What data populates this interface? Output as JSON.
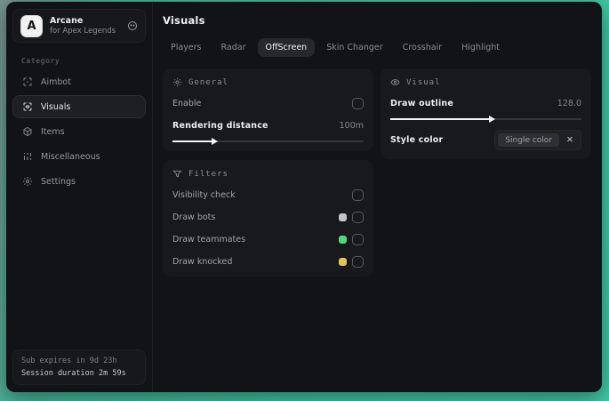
{
  "app": {
    "title": "Arcane",
    "subtitle": "for Apex Legends",
    "logo_letter": "A"
  },
  "sidebar": {
    "category_label": "Category",
    "items": [
      {
        "label": "Aimbot"
      },
      {
        "label": "Visuals"
      },
      {
        "label": "Items"
      },
      {
        "label": "Miscellaneous"
      },
      {
        "label": "Settings"
      }
    ],
    "footer": {
      "sub_expires": "Sub expires in 9d 23h",
      "session_duration": "Session duration 2m 59s"
    }
  },
  "main": {
    "title": "Visuals",
    "tabs": [
      {
        "label": "Players"
      },
      {
        "label": "Radar"
      },
      {
        "label": "OffScreen",
        "active": true
      },
      {
        "label": "Skin Changer"
      },
      {
        "label": "Crosshair"
      },
      {
        "label": "Highlight"
      }
    ]
  },
  "panels": {
    "general": {
      "title": "General",
      "enable_label": "Enable",
      "enable_checked": false,
      "rendering_distance_label": "Rendering distance",
      "rendering_distance_value": "100m",
      "rendering_distance_percent": 21
    },
    "filters": {
      "title": "Filters",
      "rows": [
        {
          "label": "Visibility check",
          "swatch": null,
          "checked": false
        },
        {
          "label": "Draw bots",
          "swatch": "#c2c4c6",
          "checked": false
        },
        {
          "label": "Draw teammates",
          "swatch": "#4fd97f",
          "checked": false
        },
        {
          "label": "Draw knocked",
          "swatch": "#e3c44d",
          "checked": false
        }
      ]
    },
    "visual": {
      "title": "Visual",
      "draw_outline_label": "Draw outline",
      "draw_outline_value": "128.0",
      "draw_outline_percent": 52,
      "style_color_label": "Style color",
      "style_color_tag": "Single color",
      "remove_tag_glyph": "✕"
    }
  },
  "colors": {
    "desktop_teal": "#3fc4a0",
    "window_bg": "#121316",
    "panel_bg": "#18191d",
    "accent_text": "#eceded",
    "swatch_bots": "#c2c4c6",
    "swatch_teammates": "#4fd97f",
    "swatch_knocked": "#e3c44d"
  }
}
